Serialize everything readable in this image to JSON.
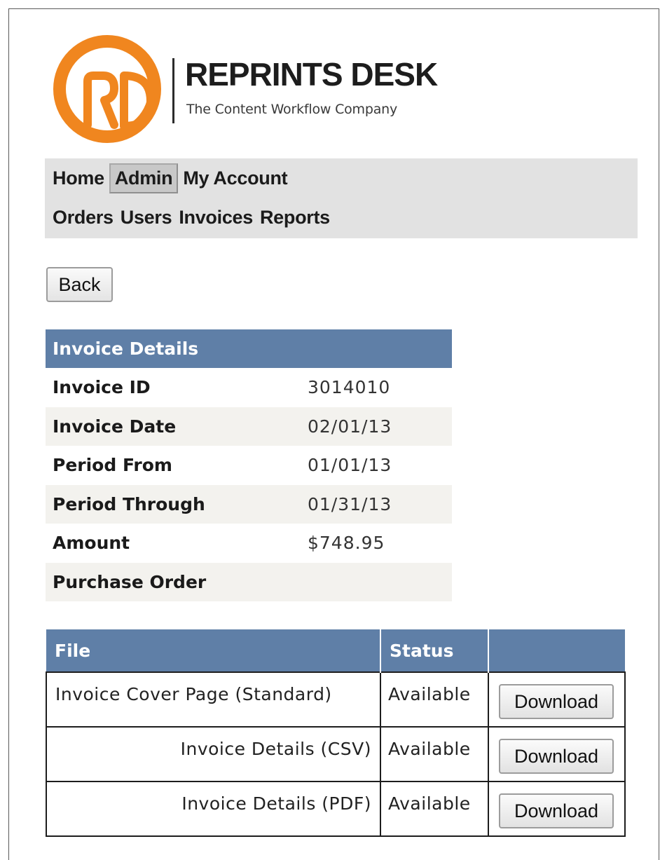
{
  "brand": {
    "name": "REPRINTS DESK",
    "tagline": "The Content Workflow Company",
    "accent_color": "#f0861f",
    "logo_icon": "rd-monogram-icon"
  },
  "nav": {
    "row1": [
      {
        "label": "Home",
        "active": false
      },
      {
        "label": "Admin",
        "active": true
      },
      {
        "label": "My Account",
        "active": false
      }
    ],
    "row2": [
      {
        "label": "Orders"
      },
      {
        "label": "Users"
      },
      {
        "label": "Invoices"
      },
      {
        "label": "Reports"
      }
    ]
  },
  "back_label": "Back",
  "invoice_details": {
    "heading": "Invoice Details",
    "header_color": "#5f7fa7",
    "rows": [
      {
        "label": "Invoice ID",
        "value": "3014010"
      },
      {
        "label": "Invoice Date",
        "value": "02/01/13"
      },
      {
        "label": "Period From",
        "value": "01/01/13"
      },
      {
        "label": "Period Through",
        "value": "01/31/13"
      },
      {
        "label": "Amount",
        "value": "$748.95"
      },
      {
        "label": "Purchase Order",
        "value": ""
      }
    ]
  },
  "files": {
    "columns": [
      "File",
      "Status",
      ""
    ],
    "rows": [
      {
        "file": "Invoice Cover Page (Standard)",
        "status": "Available",
        "action": "Download"
      },
      {
        "file": "Invoice Details (CSV)",
        "status": "Available",
        "action": "Download"
      },
      {
        "file": "Invoice Details (PDF)",
        "status": "Available",
        "action": "Download"
      }
    ]
  }
}
